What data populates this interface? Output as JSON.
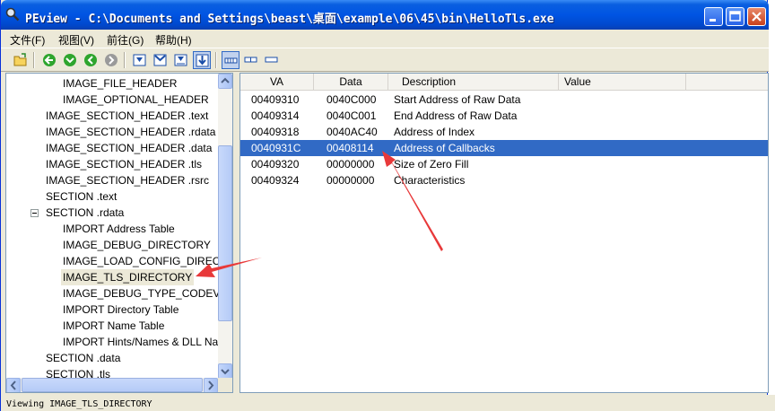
{
  "window": {
    "title": "PEview - C:\\Documents and Settings\\beast\\桌面\\example\\06\\45\\bin\\HelloTls.exe",
    "controls": [
      "minimize-icon",
      "maximize-icon",
      "close-icon"
    ]
  },
  "menu": {
    "items": [
      "文件(F)",
      "视图(V)",
      "前往(G)",
      "帮助(H)"
    ]
  },
  "toolbar": {
    "icons": [
      "open-file-icon",
      "back-icon",
      "forward-icon",
      "previous-icon",
      "next-icon",
      "section-icon-1",
      "section-icon-2",
      "section-icon-3",
      "section-icon-4",
      "view-byte-icon",
      "view-word-icon",
      "view-dword-icon"
    ],
    "pressed": [
      "section-icon-4",
      "view-byte-icon"
    ]
  },
  "tree": {
    "nodes": [
      {
        "label": "IMAGE_FILE_HEADER"
      },
      {
        "label": "IMAGE_OPTIONAL_HEADER"
      },
      {
        "label": "IMAGE_SECTION_HEADER .text"
      },
      {
        "label": "IMAGE_SECTION_HEADER .rdata"
      },
      {
        "label": "IMAGE_SECTION_HEADER .data"
      },
      {
        "label": "IMAGE_SECTION_HEADER .tls"
      },
      {
        "label": "IMAGE_SECTION_HEADER .rsrc"
      },
      {
        "label": "SECTION .text"
      },
      {
        "label": "SECTION .rdata",
        "expanded": true
      },
      {
        "label": "IMPORT Address Table"
      },
      {
        "label": "IMAGE_DEBUG_DIRECTORY"
      },
      {
        "label": "IMAGE_LOAD_CONFIG_DIRECTORY"
      },
      {
        "label": "IMAGE_TLS_DIRECTORY",
        "selected": true
      },
      {
        "label": "IMAGE_DEBUG_TYPE_CODEVIEW"
      },
      {
        "label": "IMPORT Directory Table"
      },
      {
        "label": "IMPORT Name Table"
      },
      {
        "label": "IMPORT Hints/Names & DLL Names"
      },
      {
        "label": "SECTION .data"
      },
      {
        "label": "SECTION .tls"
      }
    ]
  },
  "table": {
    "columns": [
      "VA",
      "Data",
      "Description",
      "Value"
    ],
    "rows": [
      {
        "va": "00409310",
        "data": "0040C000",
        "desc": "Start Address of Raw Data",
        "value": ""
      },
      {
        "va": "00409314",
        "data": "0040C001",
        "desc": "End Address of Raw Data",
        "value": ""
      },
      {
        "va": "00409318",
        "data": "0040AC40",
        "desc": "Address of Index",
        "value": ""
      },
      {
        "va": "0040931C",
        "data": "00408114",
        "desc": "Address of Callbacks",
        "value": "",
        "selected": true
      },
      {
        "va": "00409320",
        "data": "00000000",
        "desc": "Size of Zero Fill",
        "value": ""
      },
      {
        "va": "00409324",
        "data": "00000000",
        "desc": "Characteristics",
        "value": ""
      }
    ]
  },
  "status": {
    "text": "Viewing IMAGE_TLS_DIRECTORY"
  },
  "colors": {
    "titlebar": "#0054e3",
    "selection": "#316ac5",
    "annotation_arrow": "#e8393a"
  }
}
